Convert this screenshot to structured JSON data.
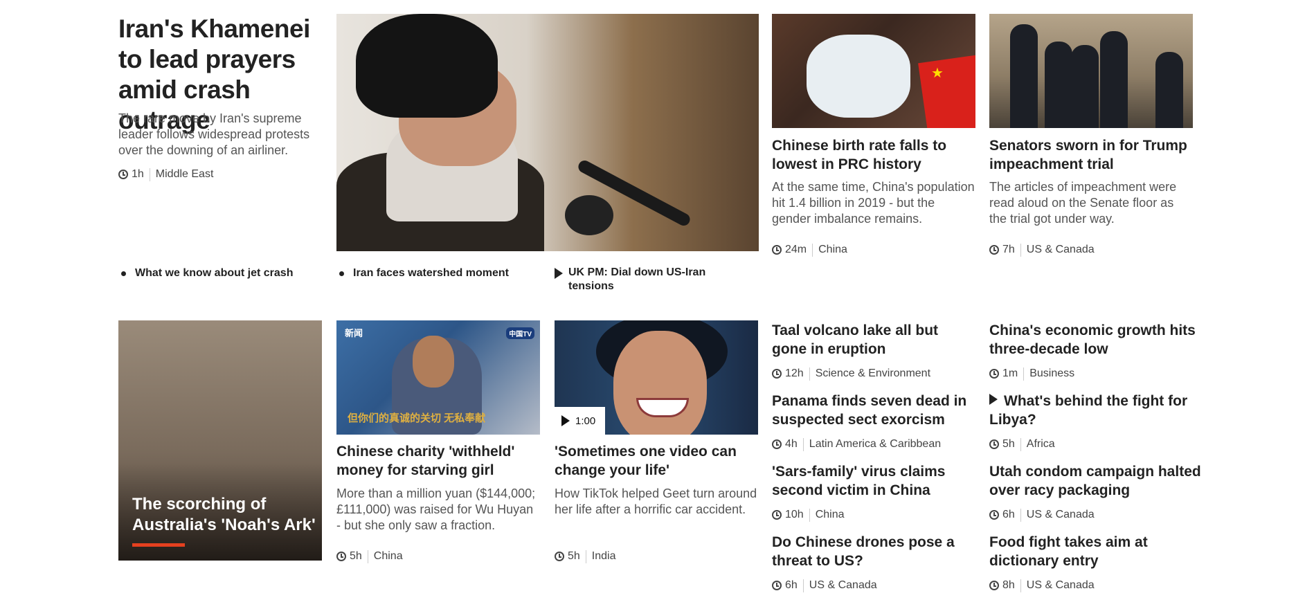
{
  "lead": {
    "title": "Iran's Khamenei to lead prayers amid crash outrage",
    "summary": "The rare move by Iran's supreme leader follows widespread protests over the downing of an airliner.",
    "time": "1h",
    "section": "Middle East",
    "related": [
      {
        "label": "What we know about jet crash",
        "type": "bullet"
      },
      {
        "label": "Iran faces watershed moment",
        "type": "bullet"
      },
      {
        "label": "UK PM: Dial down US-Iran tensions",
        "type": "video"
      }
    ]
  },
  "top_cards": [
    {
      "title": "Chinese birth rate falls to lowest in PRC history",
      "summary": "At the same time, China's population hit 1.4 billion in 2019 - but the gender imbalance remains.",
      "time": "24m",
      "section": "China"
    },
    {
      "title": "Senators sworn in for Trump impeachment trial",
      "summary": "The articles of impeachment were read aloud on the Senate floor as the trial got under way.",
      "time": "7h",
      "section": "US & Canada"
    }
  ],
  "feature": {
    "title": "The scorching of Australia's 'Noah's Ark'"
  },
  "mid_cards": [
    {
      "title": "Chinese charity 'withheld' money for starving girl",
      "summary": "More than a million yuan ($144,000; £111,000) was raised for Wu Huyan - but she only saw a fraction.",
      "time": "5h",
      "section": "China",
      "image_text": {
        "logo": "新闻",
        "logo2": "中国TV",
        "sub": "但你们的真诚的关切 无私奉献"
      }
    },
    {
      "title": "'Sometimes one video can change your life'",
      "summary": "How TikTok helped Geet turn around her life after a horrific car accident.",
      "time": "5h",
      "section": "India",
      "video_duration": "1:00"
    }
  ],
  "list_col1": [
    {
      "title": "Taal volcano lake all but gone in eruption",
      "time": "12h",
      "section": "Science & Environment"
    },
    {
      "title": "Panama finds seven dead in suspected sect exorcism",
      "time": "4h",
      "section": "Latin America & Caribbean"
    },
    {
      "title": "'Sars-family' virus claims second victim in China",
      "time": "10h",
      "section": "China"
    },
    {
      "title": "Do Chinese drones pose a threat to US?",
      "time": "6h",
      "section": "US & Canada"
    }
  ],
  "list_col2": [
    {
      "title": "China's economic growth hits three-decade low",
      "time": "1m",
      "section": "Business"
    },
    {
      "title": "What's behind the fight for Libya?",
      "time": "5h",
      "section": "Africa",
      "video": true
    },
    {
      "title": "Utah condom campaign halted over racy packaging",
      "time": "6h",
      "section": "US & Canada"
    },
    {
      "title": "Food fight takes aim at dictionary entry",
      "time": "8h",
      "section": "US & Canada"
    }
  ],
  "colors": {
    "accent_red": "#e5401f",
    "text": "#222222",
    "muted": "#555555",
    "flag_red": "#d9211b"
  }
}
